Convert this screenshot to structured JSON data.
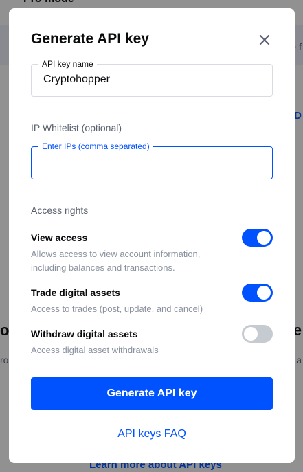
{
  "background": {
    "top_text": "Pro mode",
    "side_f": "e f",
    "side_d": "D",
    "heading_left": "ou",
    "heading_right": "e",
    "sub_left": "ro",
    "sub_right": "a",
    "learn_link": "Learn more about API keys"
  },
  "modal": {
    "title": "Generate API key",
    "close_icon": "close-icon",
    "api_key_name": {
      "label": "API key name",
      "value": "Cryptohopper"
    },
    "ip_whitelist": {
      "section_label": "IP Whitelist (optional)",
      "label": "Enter IPs (comma separated)",
      "value": ""
    },
    "access_rights": {
      "section_label": "Access rights",
      "items": [
        {
          "title": "View access",
          "description": "Allows access to view account information, including balances and transactions.",
          "enabled": true
        },
        {
          "title": "Trade digital assets",
          "description": "Access to trades (post, update, and cancel)",
          "enabled": true
        },
        {
          "title": "Withdraw digital assets",
          "description": "Access digital asset withdrawals",
          "enabled": false
        }
      ]
    },
    "generate_button": "Generate API key",
    "faq_link": "API keys FAQ"
  },
  "colors": {
    "accent": "#0052ff",
    "toggle_off": "#c6cad1",
    "text_primary": "#0a0b0d",
    "text_secondary": "#5b616e"
  }
}
